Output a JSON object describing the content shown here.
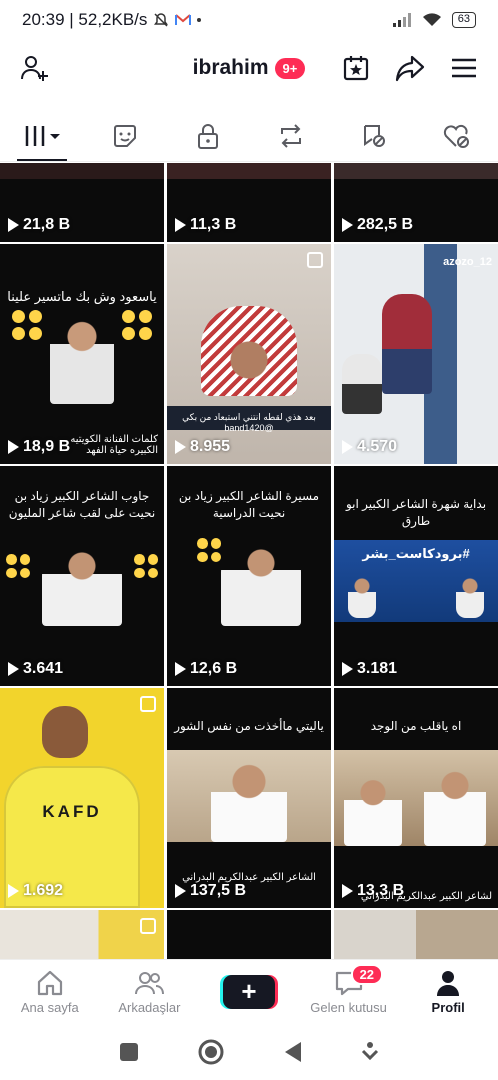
{
  "status_bar": {
    "time_speed": "20:39 | 52,2KB/s",
    "battery": "63"
  },
  "header": {
    "username": "ibrahim",
    "notif_badge": "9+"
  },
  "tabs": [
    {
      "name": "videos",
      "active": true
    },
    {
      "name": "stickers"
    },
    {
      "name": "private"
    },
    {
      "name": "reposts"
    },
    {
      "name": "favorites"
    },
    {
      "name": "liked"
    }
  ],
  "grid": {
    "row1": [
      "21,8 B",
      "11,3 B",
      "282,5 B"
    ],
    "row2": [
      {
        "views": "18,9 B",
        "caption": "ياسعود وش بك ماتسير علينا",
        "bottom": "كلمات الفنانة الكويتيه الكبيره حياة الفهد"
      },
      {
        "views": "8.955",
        "bottom": "بعد هذي لقطه انتني استبعاد من بكي @band1420"
      },
      {
        "views": "4.570",
        "tag": "azozo_12"
      }
    ],
    "row3": [
      {
        "views": "3.641",
        "caption": "جاوب الشاعر الكبير زياد بن نحيت على لقب شاعر المليون"
      },
      {
        "views": "12,6 B",
        "caption": "مسيرة الشاعر الكبير زياد بن نحيت الدراسية"
      },
      {
        "views": "3.181",
        "caption": "بداية شهرة الشاعر الكبير ابو طارق",
        "banner": "#برودكاست_بشر"
      }
    ],
    "row4": [
      {
        "views": "1.692",
        "jersey": "KAFD"
      },
      {
        "views": "137,5 B",
        "caption": "ياليتي ماأخذت من نفس الشور",
        "bottom": "الشاعر الكبير عبدالكريم البدراني"
      },
      {
        "views": "13,3 B",
        "caption": "اه ياقلب من الوجد",
        "bottom": "لشاعر الكبير عبدالكريم البدراني"
      }
    ]
  },
  "bottom_nav": [
    {
      "label": "Ana sayfa"
    },
    {
      "label": "Arkadaşlar"
    },
    {
      "label": "+"
    },
    {
      "label": "Gelen kutusu",
      "badge": "22"
    },
    {
      "label": "Profil",
      "active": true
    }
  ],
  "colors": {
    "accent": "#fe2c55",
    "cyan": "#25f4ee",
    "dark": "#161823"
  }
}
